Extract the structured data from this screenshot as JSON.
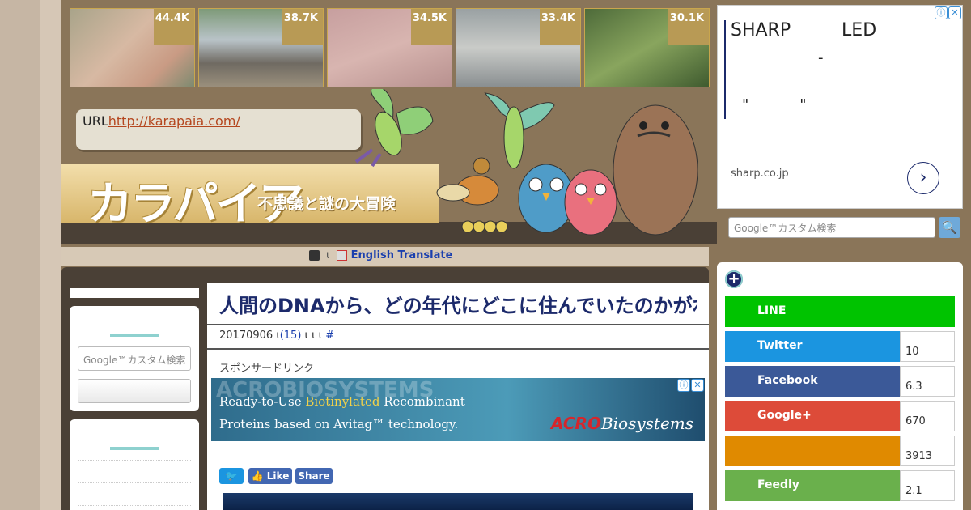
{
  "thumbnails": [
    {
      "count": "44.4K",
      "color": "linear-gradient(135deg,#a9a48a,#d7b9a3 45%,#c99b84 75%,#7d8a70)"
    },
    {
      "count": "38.7K",
      "color": "linear-gradient(180deg,#7e9a79,#b9c3c8 40%,#6f6a62 70%,#9a8f7c)"
    },
    {
      "count": "34.5K",
      "color": "linear-gradient(160deg,#c79f9f,#d8b5b0 50%,#b8918f)"
    },
    {
      "count": "33.4K",
      "color": "linear-gradient(180deg,#9aa1a3,#c9cbc8 50%,#8a8f91)"
    },
    {
      "count": "30.1K",
      "color": "linear-gradient(150deg,#4e6b3a,#89a55e 50%,#3f5b2f)"
    }
  ],
  "url_box": {
    "label": "URL",
    "link": "http://karapaia.com/"
  },
  "logo": {
    "title": "カラパイア",
    "subtitle": "不思議と謎の大冒険"
  },
  "top_ad": {
    "headline": "SHARP         LED",
    "dash": "-",
    "quote": "\"           \"",
    "site": "sharp.co.jp",
    "arrow": "›",
    "info": "ⓘ",
    "close": "✕"
  },
  "header_search": {
    "placeholder": "Google™カスタム検索",
    "button": "🔍"
  },
  "translate_bar": {
    "sep": "ι",
    "label": "English Translate"
  },
  "left_search": {
    "placeholder": "Google™カスタム検索"
  },
  "article": {
    "title": "人間のDNAから、どの年代にどこに住んでいたのかがわかるようになった模様",
    "meta_date": "20170906",
    "meta_sep": "ι",
    "comments": "(15)",
    "meta_tail": "ι  ι  ι",
    "hash": "#",
    "sponsor": "スポンサードリンク",
    "ad": {
      "bg_text": "ACROBIOSYSTEMS",
      "line1_a": "Ready-to-Use ",
      "line1_b": "Biotinylated",
      "line1_c": " Recombinant",
      "line2": "Proteins based on Avitag™ technology.",
      "logo_a": "ACRO",
      "logo_b": "Biosystems"
    },
    "share": {
      "tweet": "🐦",
      "like": "👍 Like",
      "share": "Share"
    }
  },
  "social": {
    "plus": "+",
    "rows": [
      {
        "label": "LINE",
        "count": "",
        "color": "#00c300"
      },
      {
        "label": "Twitter",
        "count": "10",
        "color": "#1b95e0"
      },
      {
        "label": "Facebook",
        "count": "6.3",
        "color": "#3b5998"
      },
      {
        "label": "Google+",
        "count": "670",
        "color": "#dd4b39"
      },
      {
        "label": "",
        "count": "3913",
        "color": "#e08a00"
      },
      {
        "label": "Feedly",
        "count": "2.1",
        "color": "#6cc655"
      }
    ]
  }
}
